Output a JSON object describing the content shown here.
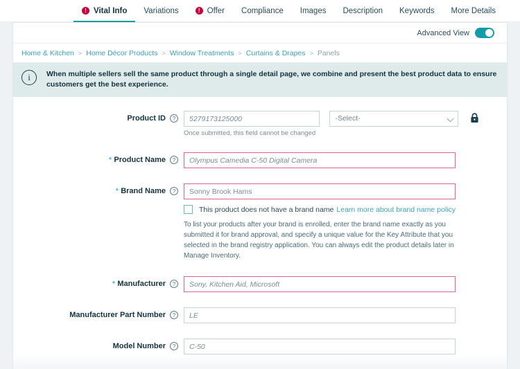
{
  "tabs": [
    {
      "label": "Vital Info",
      "active": true,
      "error": true
    },
    {
      "label": "Variations",
      "active": false,
      "error": false
    },
    {
      "label": "Offer",
      "active": false,
      "error": true
    },
    {
      "label": "Compliance",
      "active": false,
      "error": false
    },
    {
      "label": "Images",
      "active": false,
      "error": false
    },
    {
      "label": "Description",
      "active": false,
      "error": false
    },
    {
      "label": "Keywords",
      "active": false,
      "error": false
    },
    {
      "label": "More Details",
      "active": false,
      "error": false
    }
  ],
  "advanced_view": {
    "label": "Advanced View",
    "enabled": true
  },
  "breadcrumb": {
    "items": [
      "Home & Kitchen",
      "Home Décor Products",
      "Window Treatments",
      "Curtains & Drapes",
      "Panels"
    ],
    "separator": ">",
    "current": "Panels"
  },
  "banner": {
    "icon": "info-icon",
    "text": "When multiple sellers sell the same product through a single detail page, we combine and present the best product data to ensure customers get the best experience."
  },
  "form": {
    "product_id": {
      "label": "Product ID",
      "required": false,
      "value": "5279173125000",
      "select_value": "-Select-",
      "hint": "Once submitted, this field cannot be changed",
      "locked": true
    },
    "product_name": {
      "label": "Product Name",
      "required": true,
      "value": "Olympus Camedia C-50 Digital Camera",
      "error": true
    },
    "brand_name": {
      "label": "Brand Name",
      "required": true,
      "value": "Sonny Brook Hams",
      "error": true,
      "checkbox_label": "This product does not have a brand name",
      "checkbox_checked": false,
      "policy_link": "Learn more about brand name policy",
      "help_text": "To list your products after your brand is enrolled, enter the brand name exactly as you submitted it for brand approval, and specify a unique value for the Key Attribute that you selected in the brand registry application. You can always edit the product details later in Manage Inventory."
    },
    "manufacturer": {
      "label": "Manufacturer",
      "required": true,
      "value": "Sony, Kitchen Aid, Microsoft",
      "error": true
    },
    "manufacturer_part_number": {
      "label": "Manufacturer Part Number",
      "required": false,
      "value": "LE",
      "error": false
    },
    "model_number": {
      "label": "Model Number",
      "required": false,
      "value": "C-50",
      "error": false
    }
  },
  "icons": {
    "help": "?",
    "error_mark": "!",
    "info": "i"
  },
  "colors": {
    "accent_teal": "#1b9aaa",
    "link_teal": "#3d9fb5",
    "error_red": "#c7003e",
    "error_border": "#e06287",
    "banner_bg": "#dfeaea",
    "required_star": "#31a5c4"
  }
}
